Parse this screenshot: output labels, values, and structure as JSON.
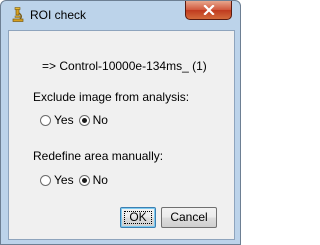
{
  "window": {
    "title": "ROI check",
    "icon": "microscope-icon",
    "close": "close-icon"
  },
  "dialog": {
    "image_name": "=> Control-10000e-134ms_ (1)",
    "exclude": {
      "label": "Exclude image from analysis:",
      "options": [
        "Yes",
        "No"
      ],
      "selected": "No"
    },
    "redefine": {
      "label": "Redefine area manually:",
      "options": [
        "Yes",
        "No"
      ],
      "selected": "No"
    },
    "ok_label": "OK",
    "cancel_label": "Cancel"
  },
  "colors": {
    "frame": "#bcd3ea",
    "client": "#f0f0f0",
    "close": "#c7442a"
  }
}
